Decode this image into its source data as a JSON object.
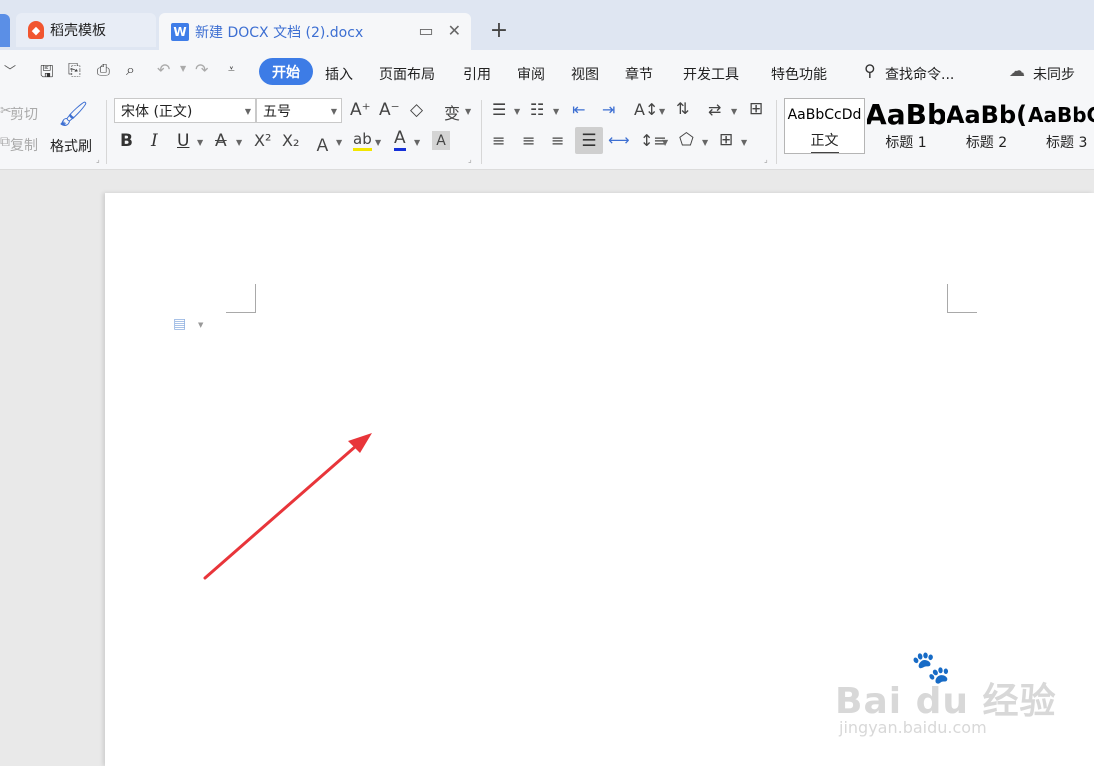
{
  "tabs": {
    "template_tab": "稻壳模板",
    "doc_tab": "新建 DOCX 文档 (2).docx",
    "doc_icon": "W",
    "new_tab": "+"
  },
  "menu": {
    "active": "开始",
    "items": [
      "插入",
      "页面布局",
      "引用",
      "审阅",
      "视图",
      "章节",
      "开发工具",
      "特色功能"
    ],
    "search": "查找命令...",
    "sync": "未同步"
  },
  "toolbar": {
    "cut": "剪切",
    "copy": "复制",
    "format_painter": "格式刷",
    "font_name": "宋体 (正文)",
    "font_size": "五号",
    "bold": "B",
    "italic": "I",
    "underline": "U"
  },
  "styles": [
    {
      "sample": "AaBbCcDd",
      "label": "正文"
    },
    {
      "sample": "AaBb",
      "label": "标题 1"
    },
    {
      "sample": "AaBb(",
      "label": "标题 2"
    },
    {
      "sample": "AaBbC",
      "label": "标题 3"
    }
  ],
  "watermark": {
    "main": "Bai  du 经验",
    "url": "jingyan.baidu.com"
  },
  "colors": {
    "accent": "#3d7ce6",
    "arrow": "#e8353a"
  }
}
